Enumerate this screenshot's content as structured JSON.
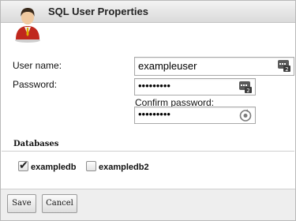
{
  "window": {
    "title": "SQL User Properties"
  },
  "form": {
    "username_label": "User name:",
    "username_value": "exampleuser",
    "password_label": "Password:",
    "password_value": "•••••••••",
    "confirm_label": "Confirm password:",
    "confirm_value": "•••••••••"
  },
  "databases": {
    "section_title": "Databases",
    "items": [
      {
        "label": "exampledb",
        "checked": true
      },
      {
        "label": "exampledb2",
        "checked": false
      }
    ]
  },
  "buttons": {
    "save": "Save",
    "cancel": "Cancel"
  },
  "icons": {
    "avatar": "user-avatar-icon",
    "field_badge": "keyboard-badge-icon",
    "generate": "generate-password-icon"
  }
}
